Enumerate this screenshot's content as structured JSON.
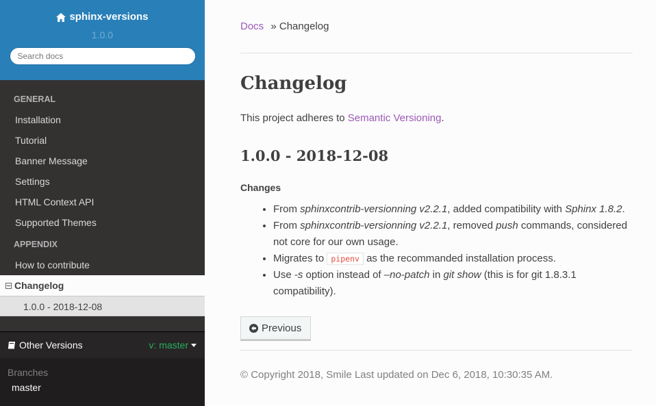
{
  "sidebar": {
    "project": "sphinx-versions",
    "version": "1.0.0",
    "search_placeholder": "Search docs",
    "caption_general": "GENERAL",
    "general_items": [
      "Installation",
      "Tutorial",
      "Banner Message",
      "Settings",
      "HTML Context API",
      "Supported Themes"
    ],
    "caption_appendix": "APPENDIX",
    "appendix_items": [
      "How to contribute"
    ],
    "current": "Changelog",
    "current_sub": "1.0.0 - 2018-12-08"
  },
  "versions": {
    "label": "Other Versions",
    "current": "v: master",
    "branches_label": "Branches",
    "branch": "master"
  },
  "breadcrumb": {
    "docs": "Docs",
    "sep": "»",
    "current": "Changelog"
  },
  "main": {
    "title": "Changelog",
    "lead_text": "This project adheres to ",
    "lead_link": "Semantic Versioning",
    "lead_end": ".",
    "section_title": "1.0.0 - 2018-12-08",
    "changes_label": "Changes",
    "items": {
      "i1": {
        "a": "From ",
        "b": "sphinxcontrib-versionning v2.2.1",
        "c": ", added compatibility with ",
        "d": "Sphinx 1.8.2",
        "e": "."
      },
      "i2": {
        "a": "From ",
        "b": "sphinxcontrib-versionning v2.2.1",
        "c": ", removed ",
        "d": "push",
        "e": " commands, considered not core for our own usage."
      },
      "i3": {
        "a": "Migrates to ",
        "code": "pipenv",
        "c": " as the recommanded installation process."
      },
      "i4": {
        "a": "Use ",
        "b": "-s",
        "c": " option instead of ",
        "d": "–no-patch",
        "e": " in ",
        "f": "git show",
        "g": " (this is for git 1.8.3.1 compatibility)."
      }
    },
    "previous_label": "Previous"
  },
  "footer": {
    "text": "© Copyright 2018, Smile Last updated on Dec 6, 2018, 10:30:35 AM."
  },
  "colors": {
    "sidebar_top": "#2980b9",
    "sidebar_bg": "#343131",
    "link": "#9b59b6",
    "version_green": "#27ae60"
  }
}
